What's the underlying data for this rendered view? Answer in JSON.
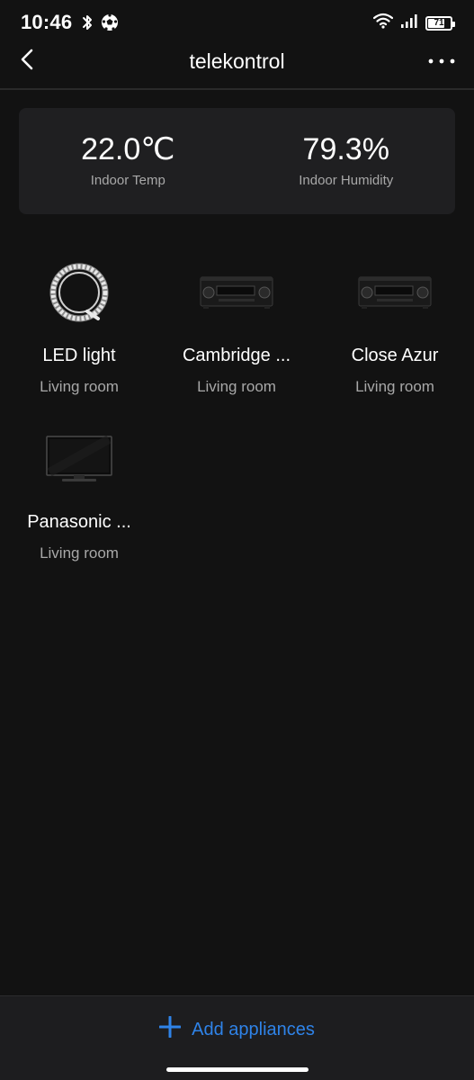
{
  "status_bar": {
    "time": "10:46",
    "battery_level": "71",
    "icons_left": [
      "bluetooth-icon",
      "soccer-ball-icon"
    ],
    "icons_right": [
      "wifi-icon",
      "signal-icon",
      "battery-icon"
    ]
  },
  "header": {
    "title": "telekontrol",
    "back_icon": "chevron-left-icon",
    "more_icon": "more-horizontal-icon"
  },
  "climate": {
    "temperature_value": "22.0℃",
    "temperature_label": "Indoor Temp",
    "humidity_value": "79.3%",
    "humidity_label": "Indoor Humidity"
  },
  "devices": [
    {
      "name": "LED light",
      "room": "Living room",
      "image": "led-strip-icon"
    },
    {
      "name": "Cambridge ...",
      "room": "Living room",
      "image": "av-receiver-icon"
    },
    {
      "name": "Close Azur",
      "room": "Living room",
      "image": "av-receiver-icon"
    },
    {
      "name": "Panasonic ...",
      "room": "Living room",
      "image": "television-icon"
    }
  ],
  "bottom_bar": {
    "add_label": "Add appliances",
    "add_icon": "plus-icon",
    "accent_color": "#2f83e8"
  }
}
